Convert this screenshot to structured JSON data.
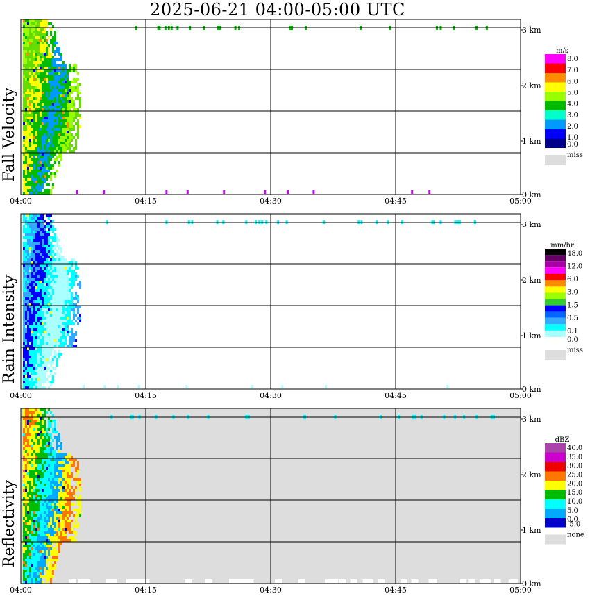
{
  "title": "2025-06-21   04:00-05:00 UTC",
  "chart_data": [
    {
      "type": "heatmap",
      "ylabel": "Fall Velocity",
      "x_ticks": [
        "04:00",
        "04:15",
        "04:30",
        "04:45",
        "05:00"
      ],
      "y_ticks": [
        "0 km",
        "1 km",
        "2 km",
        "3 km"
      ],
      "xlim": [
        "04:00",
        "05:00"
      ],
      "ylim_km": [
        0,
        3.3
      ],
      "grid": true,
      "background": "#ffffff",
      "legend_unit": "m/s",
      "legend_labels": [
        "8.0",
        "7.0",
        "6.0",
        "5.0",
        "4.0",
        "3.0",
        "2.0",
        "1.0",
        "0.0"
      ],
      "legend_colors": [
        "#ff00ff",
        "#ff0000",
        "#ff8c00",
        "#ffff00",
        "#99ff00",
        "#00bb00",
        "#00ffcc",
        "#0099ff",
        "#0000ff",
        "#00008b"
      ],
      "legend_missing": "miss",
      "core_colors": [
        "#00bb00",
        "#99ff00",
        "#66dd00",
        "#ffff00",
        "#00bb00",
        "#0099ff"
      ],
      "edge_colors": [
        "#00bb00",
        "#99ff00",
        "#0000ff",
        "#ff8c00"
      ]
    },
    {
      "type": "heatmap",
      "ylabel": "Rain Intensity",
      "x_ticks": [
        "04:00",
        "04:15",
        "04:30",
        "04:45",
        "05:00"
      ],
      "y_ticks": [
        "0 km",
        "1 km",
        "2 km",
        "3 km"
      ],
      "xlim": [
        "04:00",
        "05:00"
      ],
      "ylim_km": [
        0,
        3.3
      ],
      "grid": true,
      "background": "#ffffff",
      "legend_unit": "mm/hr",
      "legend_labels": [
        "48.0",
        "12.0",
        "6.0",
        "3.0",
        "1.5",
        "0.5",
        "0.1",
        "0.0"
      ],
      "legend_colors": [
        "#000000",
        "#660066",
        "#aa00aa",
        "#ff00ff",
        "#ff0000",
        "#ff8c00",
        "#ffff00",
        "#99ff00",
        "#33cc33",
        "#0000ff",
        "#0066ff",
        "#33aaff",
        "#00ffff",
        "#aaffff",
        "#ffffff"
      ],
      "legend_missing": "miss",
      "core_colors": [
        "#aaffff",
        "#00ffff",
        "#33aaff",
        "#0000ff",
        "#00ffff",
        "#aaffff"
      ],
      "edge_colors": [
        "#aaffff",
        "#00ffff",
        "#0000ff",
        "#ffff00"
      ]
    },
    {
      "type": "heatmap",
      "ylabel": "Reflectivity",
      "x_ticks": [
        "04:00",
        "04:15",
        "04:30",
        "04:45",
        "05:00"
      ],
      "y_ticks": [
        "0 km",
        "1 km",
        "2 km",
        "3 km"
      ],
      "xlim": [
        "04:00",
        "05:00"
      ],
      "ylim_km": [
        0,
        3.3
      ],
      "grid": true,
      "background": "#dddddd",
      "legend_unit": "dBZ",
      "legend_labels": [
        "40.0",
        "35.0",
        "30.0",
        "25.0",
        "20.0",
        "15.0",
        "10.0",
        "5.0",
        "0.0",
        "-5.0"
      ],
      "legend_colors": [
        "#aa44aa",
        "#cc00cc",
        "#ee0000",
        "#ff7700",
        "#ffff00",
        "#00bb00",
        "#00ffff",
        "#00aaff",
        "#0000cc"
      ],
      "legend_missing": "none",
      "core_colors": [
        "#ffff00",
        "#ff7700",
        "#ffff00",
        "#00bb00",
        "#00ffff",
        "#00aaff"
      ],
      "edge_colors": [
        "#00bb00",
        "#00ffff",
        "#0000cc",
        "#ff7700"
      ]
    }
  ]
}
